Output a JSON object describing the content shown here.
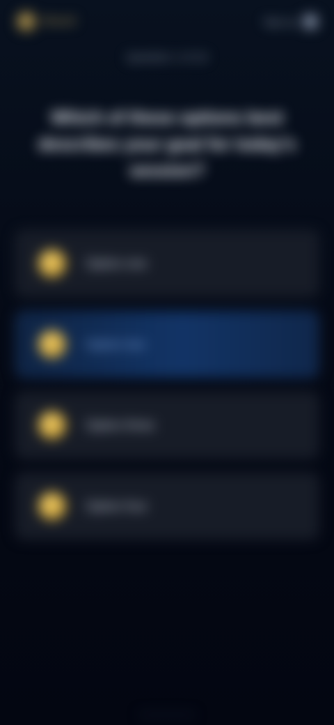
{
  "topbar": {
    "brand_name": "Brand",
    "link_label": "Sign up"
  },
  "header": {
    "eyebrow": "Question 1 of 10",
    "question": "Which of these options best describes your goal for today's session?"
  },
  "options": [
    {
      "label": "Option one",
      "selected": false
    },
    {
      "label": "Option two",
      "selected": true
    },
    {
      "label": "Option three",
      "selected": false
    },
    {
      "label": "Option four",
      "selected": false
    }
  ],
  "colors": {
    "background": "#050a16",
    "card": "#171c27",
    "selected_card": "#123466",
    "accent_gold": "#d3a93f"
  }
}
